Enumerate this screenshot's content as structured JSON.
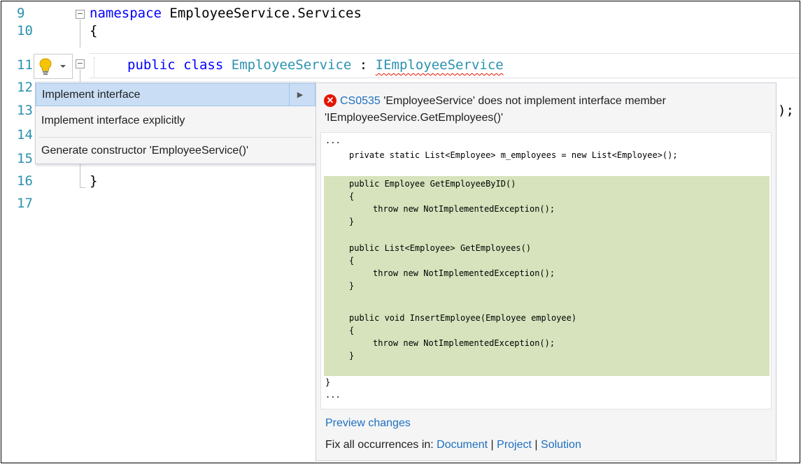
{
  "editor": {
    "line_numbers": [
      "9",
      "10",
      "11",
      "12",
      "13",
      "14",
      "15",
      "16",
      "17"
    ],
    "line9": {
      "keyword": "namespace",
      "rest": " EmployeeService.Services"
    },
    "line10": {
      "text": "{"
    },
    "line11": {
      "kw1": "public",
      "kw2": "class",
      "class_name": "EmployeeService",
      "sep": " : ",
      "interface_name": "IEmployeeService"
    },
    "line13_tail": ");",
    "line16": {
      "text": "}"
    },
    "error_squiggle_color": "#e51400"
  },
  "lightbulb": {
    "icon": "lightbulb-icon",
    "dropdown_icon": "chevron-down-icon",
    "color": "#f5c400"
  },
  "quick_actions": {
    "items": [
      {
        "label": "Implement interface",
        "selected": true,
        "has_submenu": true
      },
      {
        "label": "Implement interface explicitly"
      },
      {
        "label": "Generate constructor 'EmployeeService()'"
      }
    ]
  },
  "preview": {
    "error_code": "CS0535",
    "error_message": "'EmployeeService' does not implement interface member 'IEmployeeService.GetEmployees()'",
    "code": {
      "ellipsis_top": "...",
      "field": "private static List<Employee> m_employees = new List<Employee>();",
      "m1_sig": "public Employee GetEmployeeByID()",
      "m2_sig": "public List<Employee> GetEmployees()",
      "m3_sig": "public void InsertEmployee(Employee employee)",
      "open_brace": "{",
      "close_brace": "}",
      "throw_stmt": "throw new NotImplementedException();",
      "class_close": "}",
      "ellipsis_bottom": "..."
    },
    "preview_changes": "Preview changes",
    "fix_all_label": "Fix all occurrences in:",
    "scope_document": "Document",
    "scope_project": "Project",
    "scope_solution": "Solution",
    "scope_separator": "|"
  }
}
